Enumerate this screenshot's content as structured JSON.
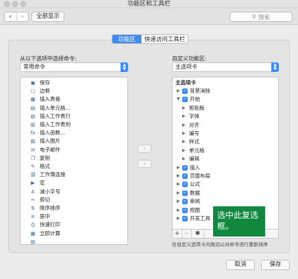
{
  "window": {
    "title": "功能区和工具栏"
  },
  "toolbar": {
    "back": "‹",
    "forward": "›",
    "show_all": "全部显示",
    "search_placeholder": "搜索"
  },
  "tabs": [
    {
      "label": "功能区",
      "active": true
    },
    {
      "label": "快速访问工具栏",
      "active": false
    }
  ],
  "left": {
    "label": "从以下选项中选择命令:",
    "selected": "常用命令",
    "items": [
      {
        "label": "保存",
        "icon": "save-icon",
        "glyph": "▣"
      },
      {
        "label": "边框",
        "icon": "border-icon",
        "glyph": "▢",
        "submenu": true
      },
      {
        "label": "插入表格",
        "icon": "table-icon",
        "glyph": "▦"
      },
      {
        "label": "插入单元格...",
        "icon": "insert-cells-icon",
        "glyph": "▤"
      },
      {
        "label": "插入工作表行",
        "icon": "insert-row-icon",
        "glyph": "▤"
      },
      {
        "label": "插入工作表列",
        "icon": "insert-column-icon",
        "glyph": "▥"
      },
      {
        "label": "插入函数...",
        "icon": "function-icon",
        "glyph": "fx"
      },
      {
        "label": "插入图片",
        "icon": "picture-icon",
        "glyph": "▨"
      },
      {
        "label": "电子邮件",
        "icon": "email-icon",
        "glyph": "✉"
      },
      {
        "label": "复制",
        "icon": "copy-icon",
        "glyph": "❐"
      },
      {
        "label": "格式",
        "icon": "format-painter-icon",
        "glyph": "✎"
      },
      {
        "label": "工作簿连接",
        "icon": "connection-icon",
        "glyph": "⛓"
      },
      {
        "label": "宏",
        "icon": "macro-icon",
        "glyph": "▶"
      },
      {
        "label": "减小字号",
        "icon": "decrease-font-icon",
        "glyph": "A"
      },
      {
        "label": "剪切",
        "icon": "cut-icon",
        "glyph": "✂"
      },
      {
        "label": "降序排序",
        "icon": "sort-desc-icon",
        "glyph": "⇅"
      },
      {
        "label": "居中",
        "icon": "center-align-icon",
        "glyph": "≡"
      },
      {
        "label": "快速打印",
        "icon": "print-icon",
        "glyph": "⎙"
      },
      {
        "label": "立即计算",
        "icon": "calculate-icon",
        "glyph": "▦"
      },
      {
        "label": "",
        "icon": "partial-icon",
        "glyph": "▤"
      }
    ]
  },
  "move": {
    "add": "›",
    "remove": "‹"
  },
  "right": {
    "label": "自定义功能区:",
    "selected": "主选项卡",
    "header": "主选项卡",
    "items": [
      {
        "label": "背景消除",
        "level": 0,
        "expanded": false,
        "checked": true
      },
      {
        "label": "开始",
        "level": 0,
        "expanded": true,
        "checked": true
      },
      {
        "label": "剪贴板",
        "level": 1,
        "expanded": false,
        "checked": false
      },
      {
        "label": "字体",
        "level": 1,
        "expanded": false,
        "checked": false
      },
      {
        "label": "对齐",
        "level": 1,
        "expanded": false,
        "checked": false
      },
      {
        "label": "编号",
        "level": 1,
        "expanded": false,
        "checked": false
      },
      {
        "label": "样式",
        "level": 1,
        "expanded": false,
        "checked": false
      },
      {
        "label": "单元格",
        "level": 1,
        "expanded": false,
        "checked": false
      },
      {
        "label": "编辑",
        "level": 1,
        "expanded": false,
        "checked": false
      },
      {
        "label": "插入",
        "level": 0,
        "expanded": false,
        "checked": true
      },
      {
        "label": "页面布局",
        "level": 0,
        "expanded": false,
        "checked": true
      },
      {
        "label": "公式",
        "level": 0,
        "expanded": false,
        "checked": true
      },
      {
        "label": "数据",
        "level": 0,
        "expanded": false,
        "checked": true
      },
      {
        "label": "审阅",
        "level": 0,
        "expanded": false,
        "checked": true
      },
      {
        "label": "视图",
        "level": 0,
        "expanded": false,
        "checked": true
      },
      {
        "label": "开发工具",
        "level": 0,
        "expanded": false,
        "checked": true
      }
    ],
    "add_symbol": "+",
    "remove_symbol": "−",
    "gear_symbol": "✱",
    "hint": "在自定义选项卡内拖动以对命令进行重新排序"
  },
  "callout": "选中此复选框。",
  "dialog": {
    "cancel": "取消",
    "save": "保存"
  },
  "colors": {
    "accent": "#3d8cf5",
    "callout": "#10893e"
  }
}
